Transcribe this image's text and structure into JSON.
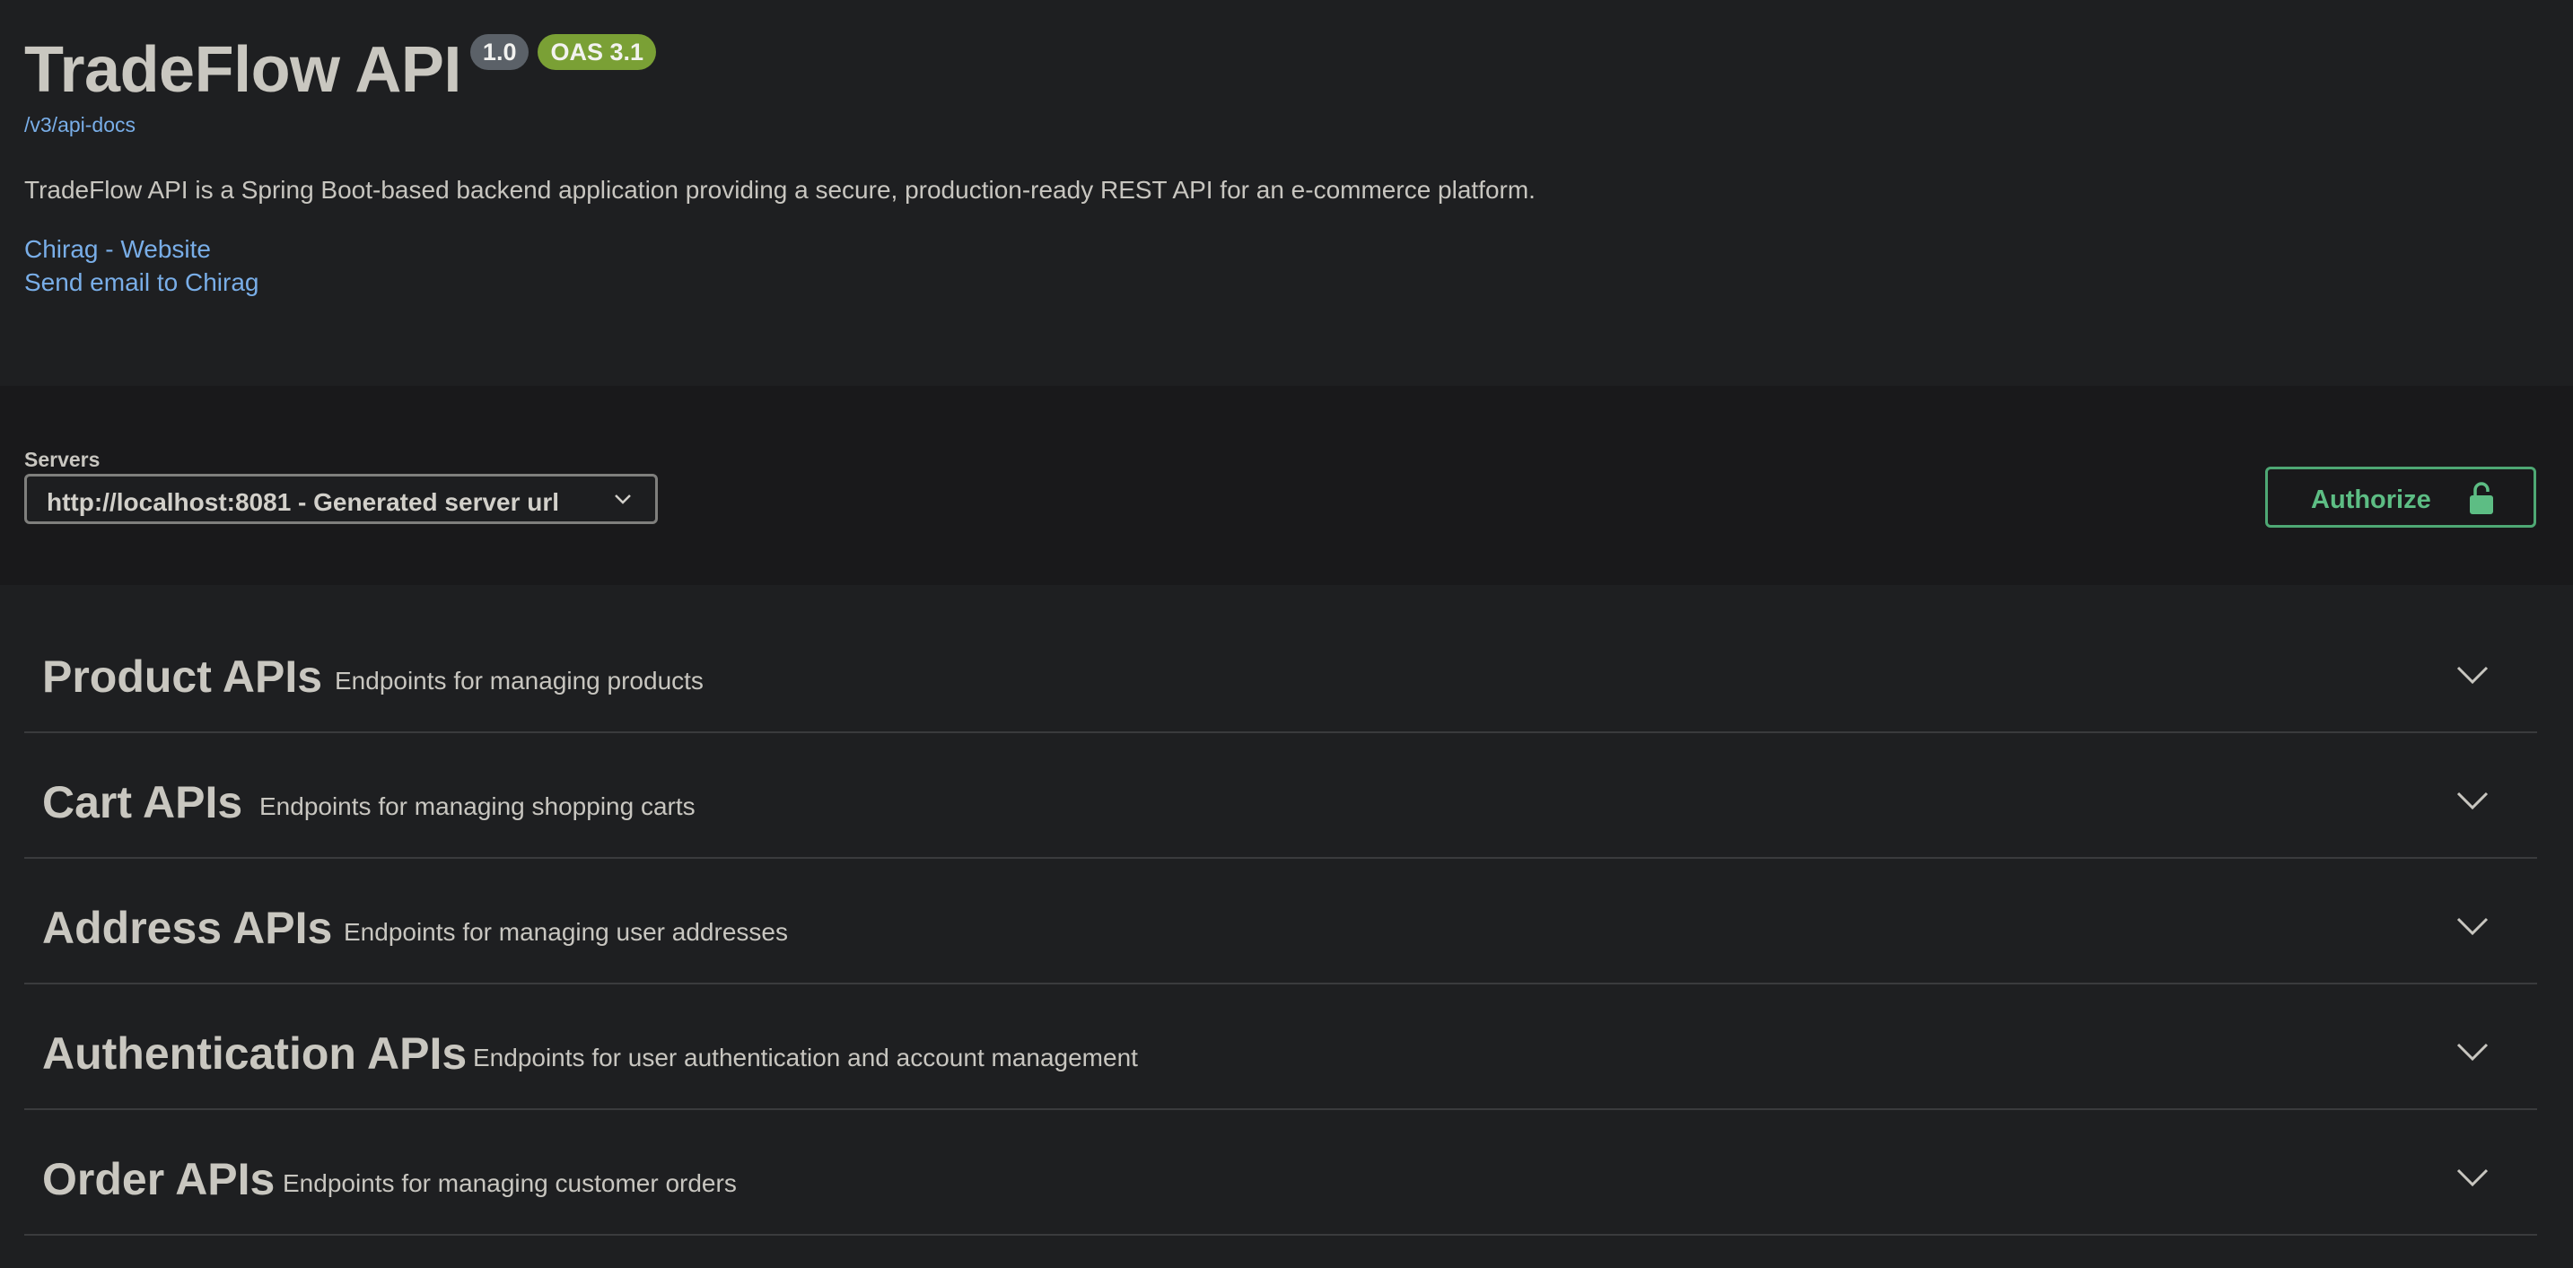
{
  "info": {
    "title": "TradeFlow API",
    "version_badge": "1.0",
    "oas_badge": "OAS 3.1",
    "docs_link": "/v3/api-docs",
    "description": "TradeFlow API is a Spring Boot-based backend application providing a secure, production-ready REST API for an e-commerce platform.",
    "contact_website": "Chirag - Website",
    "contact_email": "Send email to Chirag"
  },
  "servers": {
    "label": "Servers",
    "selected": "http://localhost:8081 - Generated server url"
  },
  "authorize": {
    "label": "Authorize",
    "icon": "unlocked-lock-icon"
  },
  "tags": [
    {
      "name": "Product APIs",
      "description": "Endpoints for managing products"
    },
    {
      "name": "Cart APIs",
      "description": "Endpoints for managing shopping carts"
    },
    {
      "name": "Address APIs",
      "description": "Endpoints for managing user addresses"
    },
    {
      "name": "Authentication APIs",
      "description": "Endpoints for user authentication and account management"
    },
    {
      "name": "Order APIs",
      "description": "Endpoints for managing customer orders"
    }
  ],
  "colors": {
    "background": "#1e1f21",
    "link": "#79aee8",
    "oas_badge": "#7aa035",
    "authorize": "#4ea874"
  }
}
